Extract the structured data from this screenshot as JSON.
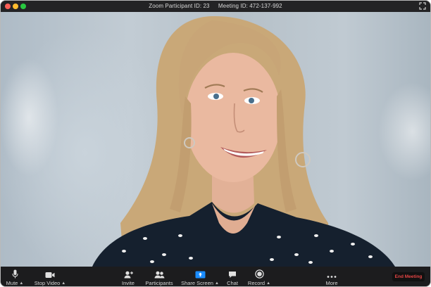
{
  "titlebar": {
    "participant_id": "Zoom Participant ID: 23",
    "meeting_id": "Meeting ID: 472-137-992"
  },
  "toolbar": {
    "mute_label": "Mute",
    "video_label": "Stop Video",
    "invite_label": "Invite",
    "participants_label": "Participants",
    "share_label": "Share Screen",
    "chat_label": "Chat",
    "record_label": "Record",
    "more_label": "More",
    "end_label": "End Meeting"
  },
  "colors": {
    "end_meeting_text": "#e64545",
    "share_icon": "#1a8cff",
    "toolbar_bg": "#1c1c1e"
  }
}
